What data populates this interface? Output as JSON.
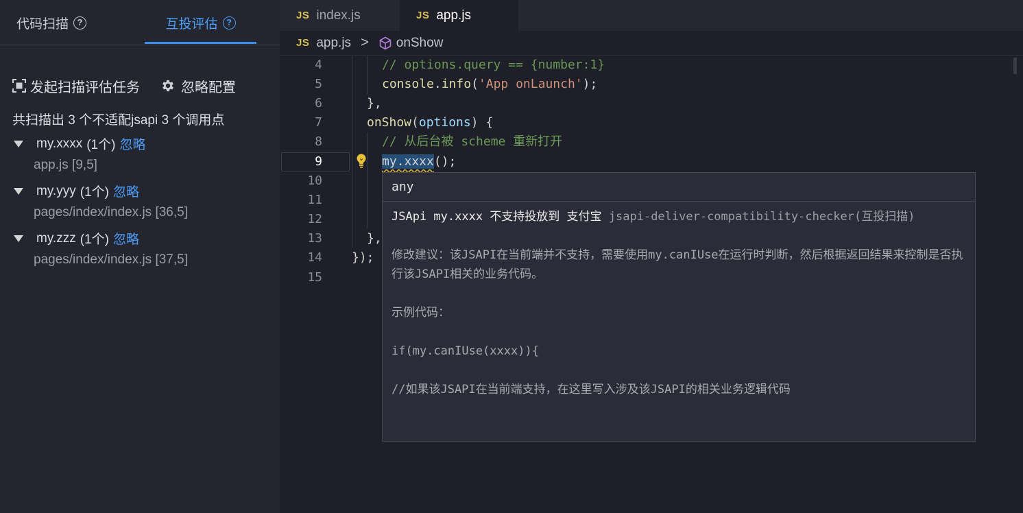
{
  "left_panel": {
    "tabs": [
      {
        "label": "代码扫描",
        "active": false
      },
      {
        "label": "互投评估",
        "active": true
      }
    ],
    "actions": {
      "start_scan_label": "发起扫描评估任务",
      "ignore_config_label": "忽略配置"
    },
    "summary": "共扫描出 3 个不适配jsapi 3 个调用点",
    "results": [
      {
        "api": "my.xxxx",
        "count": "(1个)",
        "ignore_label": "忽略",
        "location": "app.js [9,5]"
      },
      {
        "api": "my.yyy",
        "count": "(1个)",
        "ignore_label": "忽略",
        "location": "pages/index/index.js [36,5]"
      },
      {
        "api": "my.zzz",
        "count": "(1个)",
        "ignore_label": "忽略",
        "location": "pages/index/index.js [37,5]"
      }
    ]
  },
  "editor": {
    "tabs": [
      {
        "badge": "JS",
        "label": "index.js",
        "active": false
      },
      {
        "badge": "JS",
        "label": "app.js",
        "active": true
      }
    ],
    "breadcrumb": {
      "badge": "JS",
      "file": "app.js",
      "separator": ">",
      "symbol": "onShow"
    },
    "line_numbers": [
      "4",
      "5",
      "6",
      "7",
      "8",
      "9",
      "10",
      "11",
      "12",
      "13",
      "14",
      "15"
    ],
    "current_line": "9",
    "code": {
      "l4": "// options.query == {number:1}",
      "l5_fn": "console",
      "l5_dot": ".",
      "l5_method": "info",
      "l5_open": "(",
      "l5_str": "'App onLaunch'",
      "l5_close": ");",
      "l6": "},",
      "l7_fn": "onShow",
      "l7_open": "(",
      "l7_param": "options",
      "l7_close": ") {",
      "l8": "// 从后台被 scheme 重新打开",
      "l9_call": "my.xxxx",
      "l9_rest": "();",
      "l13": "},",
      "l14": "});"
    }
  },
  "tooltip": {
    "type": "any",
    "message": "JSApi my.xxxx 不支持投放到 支付宝",
    "source": "jsapi-deliver-compatibility-checker(互投扫描)",
    "suggestion": "修改建议：该JSAPI在当前端并不支持，需要使用my.canIUse在运行时判断，然后根据返回结果来控制是否执行该JSAPI相关的业务代码。",
    "example_label": "示例代码：",
    "example_code": "if(my.canIUse(xxxx)){",
    "example_comment": "//如果该JSAPI在当前端支持，在这里写入涉及该JSAPI的相关业务逻辑代码"
  },
  "colors": {
    "accent": "#3b8eea",
    "link": "#4a9df6",
    "js_badge": "#d8c152",
    "comment": "#6a9955",
    "string": "#ce9178"
  },
  "icons": [
    "help-circle-icon",
    "scan-frame-icon",
    "gear-icon",
    "tree-caret-down-icon",
    "cube-icon",
    "chevron-right-icon",
    "lightbulb-icon"
  ]
}
